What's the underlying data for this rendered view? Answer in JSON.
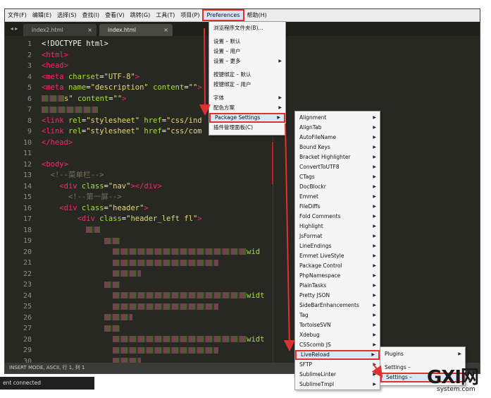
{
  "menubar": {
    "items": [
      "文件(F)",
      "编辑(E)",
      "选择(S)",
      "查找(I)",
      "查看(V)",
      "跳转(G)",
      "工具(T)",
      "项目(P)",
      "Preferences",
      "帮助(H)"
    ],
    "active_index": 8
  },
  "tabs": [
    {
      "label": "index2.html",
      "active": false
    },
    {
      "label": "index.html",
      "active": true
    }
  ],
  "tab_nav_label": "◂ ▸",
  "tab_close_glyph": "×",
  "code_lines": [
    {
      "n": "1",
      "segs": [
        {
          "c": "t-plain",
          "t": "<!DOCTYPE html>"
        }
      ]
    },
    {
      "n": "2",
      "segs": [
        {
          "c": "t-tag",
          "t": "<html>"
        }
      ]
    },
    {
      "n": "3",
      "segs": [
        {
          "c": "t-tag",
          "t": "<head>"
        }
      ]
    },
    {
      "n": "4",
      "segs": [
        {
          "c": "t-tag",
          "t": "<meta "
        },
        {
          "c": "t-attr",
          "t": "charset"
        },
        {
          "c": "t-plain",
          "t": "="
        },
        {
          "c": "t-str",
          "t": "\"UTF-8\""
        },
        {
          "c": "t-tag",
          "t": ">"
        }
      ]
    },
    {
      "n": "5",
      "segs": [
        {
          "c": "t-tag",
          "t": "<meta "
        },
        {
          "c": "t-attr",
          "t": "name"
        },
        {
          "c": "t-plain",
          "t": "="
        },
        {
          "c": "t-str",
          "t": "\"description\""
        },
        {
          "c": "t-attr",
          "t": " content"
        },
        {
          "c": "t-plain",
          "t": "="
        },
        {
          "c": "t-str",
          "t": "\"\""
        },
        {
          "c": "t-tag",
          "t": ">"
        }
      ]
    },
    {
      "n": "6",
      "segs": [
        {
          "c": "blur",
          "w": 32
        },
        {
          "c": "t-str",
          "t": "s\""
        },
        {
          "c": "t-attr",
          "t": " content"
        },
        {
          "c": "t-plain",
          "t": "="
        },
        {
          "c": "t-str",
          "t": "\"\""
        },
        {
          "c": "t-tag",
          "t": ">"
        }
      ]
    },
    {
      "n": "7",
      "segs": [
        {
          "c": "blur",
          "w": 80
        }
      ]
    },
    {
      "n": "8",
      "segs": [
        {
          "c": "t-tag",
          "t": "<link "
        },
        {
          "c": "t-attr",
          "t": "rel"
        },
        {
          "c": "t-plain",
          "t": "="
        },
        {
          "c": "t-str",
          "t": "\"stylesheet\""
        },
        {
          "c": "t-attr",
          "t": " href"
        },
        {
          "c": "t-plain",
          "t": "="
        },
        {
          "c": "t-str",
          "t": "\"css/ind"
        }
      ]
    },
    {
      "n": "9",
      "segs": [
        {
          "c": "t-tag",
          "t": "<link "
        },
        {
          "c": "t-attr",
          "t": "rel"
        },
        {
          "c": "t-plain",
          "t": "="
        },
        {
          "c": "t-str",
          "t": "\"stylesheet\""
        },
        {
          "c": "t-attr",
          "t": " href"
        },
        {
          "c": "t-plain",
          "t": "="
        },
        {
          "c": "t-str",
          "t": "\"css/com"
        }
      ]
    },
    {
      "n": "10",
      "segs": [
        {
          "c": "t-tag",
          "t": "</head>"
        }
      ]
    },
    {
      "n": "11",
      "segs": []
    },
    {
      "n": "12",
      "segs": [
        {
          "c": "t-tag",
          "t": "<body>"
        }
      ]
    },
    {
      "n": "13",
      "segs": [
        {
          "c": "t-plain",
          "t": "  "
        },
        {
          "c": "t-comment",
          "t": "<!--菜单栏-->"
        }
      ]
    },
    {
      "n": "14",
      "segs": [
        {
          "c": "t-plain",
          "t": "    "
        },
        {
          "c": "t-tag",
          "t": "<div "
        },
        {
          "c": "t-attr",
          "t": "class"
        },
        {
          "c": "t-plain",
          "t": "="
        },
        {
          "c": "t-str",
          "t": "\"nav\""
        },
        {
          "c": "t-tag",
          "t": "></div>"
        }
      ]
    },
    {
      "n": "15",
      "segs": [
        {
          "c": "t-plain",
          "t": "      "
        },
        {
          "c": "t-comment",
          "t": "<!--第一屏-->"
        }
      ]
    },
    {
      "n": "16",
      "segs": [
        {
          "c": "t-plain",
          "t": "    "
        },
        {
          "c": "t-tag",
          "t": "<div "
        },
        {
          "c": "t-attr",
          "t": "class"
        },
        {
          "c": "t-plain",
          "t": "="
        },
        {
          "c": "t-str",
          "t": "\"header\""
        },
        {
          "c": "t-tag",
          "t": ">"
        }
      ]
    },
    {
      "n": "17",
      "segs": [
        {
          "c": "t-plain",
          "t": "        "
        },
        {
          "c": "t-tag",
          "t": "<div "
        },
        {
          "c": "t-attr",
          "t": "class"
        },
        {
          "c": "t-plain",
          "t": "="
        },
        {
          "c": "t-str",
          "t": "\"header_left fl\""
        },
        {
          "c": "t-tag",
          "t": ">"
        }
      ]
    },
    {
      "n": "18",
      "segs": [
        {
          "c": "t-plain",
          "t": "          "
        },
        {
          "c": "blur",
          "w": 20
        }
      ]
    },
    {
      "n": "19",
      "segs": [
        {
          "c": "t-plain",
          "t": "              "
        },
        {
          "c": "blur",
          "w": 22
        }
      ]
    },
    {
      "n": "20",
      "segs": [
        {
          "c": "t-plain",
          "t": "                "
        },
        {
          "c": "blur",
          "w": 190
        },
        {
          "c": "t-attr",
          "t": "wid"
        }
      ]
    },
    {
      "n": "21",
      "segs": [
        {
          "c": "t-plain",
          "t": "                "
        },
        {
          "c": "blur",
          "w": 150
        }
      ]
    },
    {
      "n": "22",
      "segs": [
        {
          "c": "t-plain",
          "t": "                "
        },
        {
          "c": "blur",
          "w": 40
        }
      ]
    },
    {
      "n": "23",
      "segs": [
        {
          "c": "t-plain",
          "t": "              "
        },
        {
          "c": "blur",
          "w": 22
        }
      ]
    },
    {
      "n": "24",
      "segs": [
        {
          "c": "t-plain",
          "t": "                "
        },
        {
          "c": "blur",
          "w": 190
        },
        {
          "c": "t-attr",
          "t": "widt"
        }
      ]
    },
    {
      "n": "25",
      "segs": [
        {
          "c": "t-plain",
          "t": "                "
        },
        {
          "c": "blur",
          "w": 150
        }
      ]
    },
    {
      "n": "26",
      "segs": [
        {
          "c": "t-plain",
          "t": "              "
        },
        {
          "c": "blur",
          "w": 40
        }
      ]
    },
    {
      "n": "27",
      "segs": [
        {
          "c": "t-plain",
          "t": "              "
        },
        {
          "c": "blur",
          "w": 22
        }
      ]
    },
    {
      "n": "28",
      "segs": [
        {
          "c": "t-plain",
          "t": "                "
        },
        {
          "c": "blur",
          "w": 190
        },
        {
          "c": "t-attr",
          "t": "widt"
        }
      ]
    },
    {
      "n": "29",
      "segs": [
        {
          "c": "t-plain",
          "t": "                "
        },
        {
          "c": "blur",
          "w": 150
        }
      ]
    },
    {
      "n": "30",
      "segs": [
        {
          "c": "t-plain",
          "t": "                "
        },
        {
          "c": "blur",
          "w": 40
        }
      ]
    }
  ],
  "statusbar": {
    "text": "INSERT MODE, ASCII, 行 1, 列 1"
  },
  "console": {
    "text": "ent connected"
  },
  "preferences_menu": {
    "items": [
      {
        "label": "浏览程序文件夹(B)...",
        "arrow": false,
        "highlight": false
      },
      {
        "sep": true
      },
      {
        "label": "设置 – 默认",
        "arrow": false,
        "highlight": false
      },
      {
        "label": "设置 – 用户",
        "arrow": false,
        "highlight": false
      },
      {
        "label": "设置 – 更多",
        "arrow": true,
        "highlight": false
      },
      {
        "sep": true
      },
      {
        "label": "按键绑定 – 默认",
        "arrow": false,
        "highlight": false
      },
      {
        "label": "按键绑定 – 用户",
        "arrow": false,
        "highlight": false
      },
      {
        "sep": true
      },
      {
        "label": "字体",
        "arrow": true,
        "highlight": false
      },
      {
        "label": "配色方案",
        "arrow": true,
        "highlight": false
      },
      {
        "label": "Package Settings",
        "arrow": true,
        "highlight": true
      },
      {
        "label": "插件管理面板(C)",
        "arrow": false,
        "highlight": false
      }
    ]
  },
  "package_settings_menu": {
    "items": [
      {
        "label": "Alignment",
        "highlight": false
      },
      {
        "label": "AlignTab",
        "highlight": false
      },
      {
        "label": "AutoFileName",
        "highlight": false
      },
      {
        "label": "Bound Keys",
        "highlight": false
      },
      {
        "label": "Bracket Highlighter",
        "highlight": false
      },
      {
        "label": "ConvertToUTF8",
        "highlight": false
      },
      {
        "label": "CTags",
        "highlight": false
      },
      {
        "label": "DocBlockr",
        "highlight": false
      },
      {
        "label": "Emmet",
        "highlight": false
      },
      {
        "label": "FileDiffs",
        "highlight": false
      },
      {
        "label": "Fold Comments",
        "highlight": false
      },
      {
        "label": "Highlight",
        "highlight": false
      },
      {
        "label": "JsFormat",
        "highlight": false
      },
      {
        "label": "LineEndings",
        "highlight": false
      },
      {
        "label": "Emmet LiveStyle",
        "highlight": false
      },
      {
        "label": "Package Control",
        "highlight": false
      },
      {
        "label": "PhpNamespace",
        "highlight": false
      },
      {
        "label": "PlainTasks",
        "highlight": false
      },
      {
        "label": "Pretty JSON",
        "highlight": false
      },
      {
        "label": "SideBarEnhancements",
        "highlight": false
      },
      {
        "label": "Tag",
        "highlight": false
      },
      {
        "label": "TortoiseSVN",
        "highlight": false
      },
      {
        "label": "Xdebug",
        "highlight": false
      },
      {
        "label": "CSScomb JS",
        "highlight": false
      },
      {
        "label": "LiveReload",
        "highlight": true
      },
      {
        "label": "SFTP",
        "highlight": false
      },
      {
        "label": "SublimeLinter",
        "highlight": false
      },
      {
        "label": "SublimeTmpl",
        "highlight": false
      }
    ]
  },
  "livereload_menu": {
    "items": [
      {
        "label": "Plugins",
        "arrow": true,
        "highlight": false
      },
      {
        "sep": true
      },
      {
        "label": "Settings – ",
        "arrow": false,
        "highlight": false
      },
      {
        "label": "Settings – ",
        "arrow": false,
        "highlight": true
      }
    ]
  },
  "colors": {
    "annotation_red": "#e03030",
    "editor_bg": "#272822"
  },
  "watermark": {
    "main": "GXI网",
    "sub": "system.com"
  }
}
